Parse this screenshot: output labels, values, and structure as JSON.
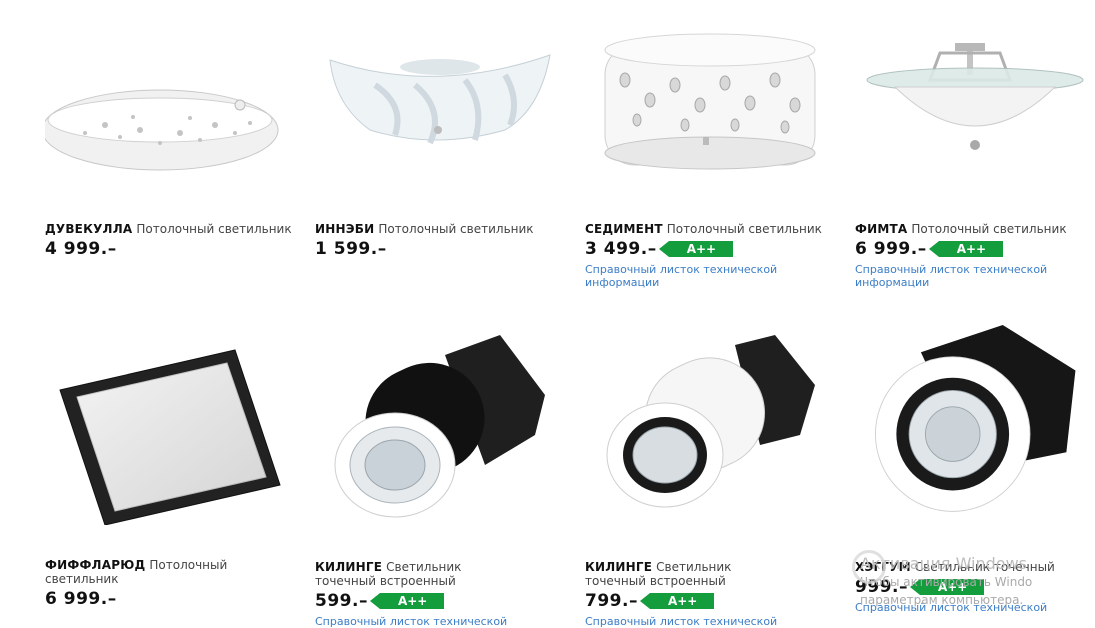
{
  "products": [
    {
      "name": "ДУВЕКУЛЛА",
      "type": "Потолочный светильник",
      "price": "4 999.–",
      "energy": "",
      "link": ""
    },
    {
      "name": "ИННЭБИ",
      "type": "Потолочный светильник",
      "price": "1 599.–",
      "energy": "",
      "link": ""
    },
    {
      "name": "СЕДИМЕНТ",
      "type": "Потолочный светильник",
      "price": "3 499.–",
      "energy": "A++",
      "link": "Справочный листок технической информации"
    },
    {
      "name": "ФИМТА",
      "type": "Потолочный светильник",
      "price": "6 999.–",
      "energy": "A++",
      "link": "Справочный листок технической информации"
    },
    {
      "name": "ФИФФЛАРЮД",
      "type": "Потолочный светильник",
      "price": "6 999.–",
      "energy": "",
      "link": ""
    },
    {
      "name": "КИЛИНГЕ",
      "type": "Светильник точечный встроенный",
      "price": "599.–",
      "energy": "A++",
      "link": "Справочный листок технической"
    },
    {
      "name": "КИЛИНГЕ",
      "type": "Светильник точечный встроенный",
      "price": "799.–",
      "energy": "A++",
      "link": "Справочный листок технической"
    },
    {
      "name": "ХЭГГУМ",
      "type": "Светильник точечный",
      "price": "999.–",
      "energy": "A++",
      "link": "Справочный листок технической"
    }
  ],
  "watermark": {
    "title": "Активация Windows",
    "line1": "Чтобы активировать Windo",
    "line2": "параметрам компьютера."
  },
  "colors": {
    "energy": "#139d3d",
    "link": "#3b7dc7"
  }
}
